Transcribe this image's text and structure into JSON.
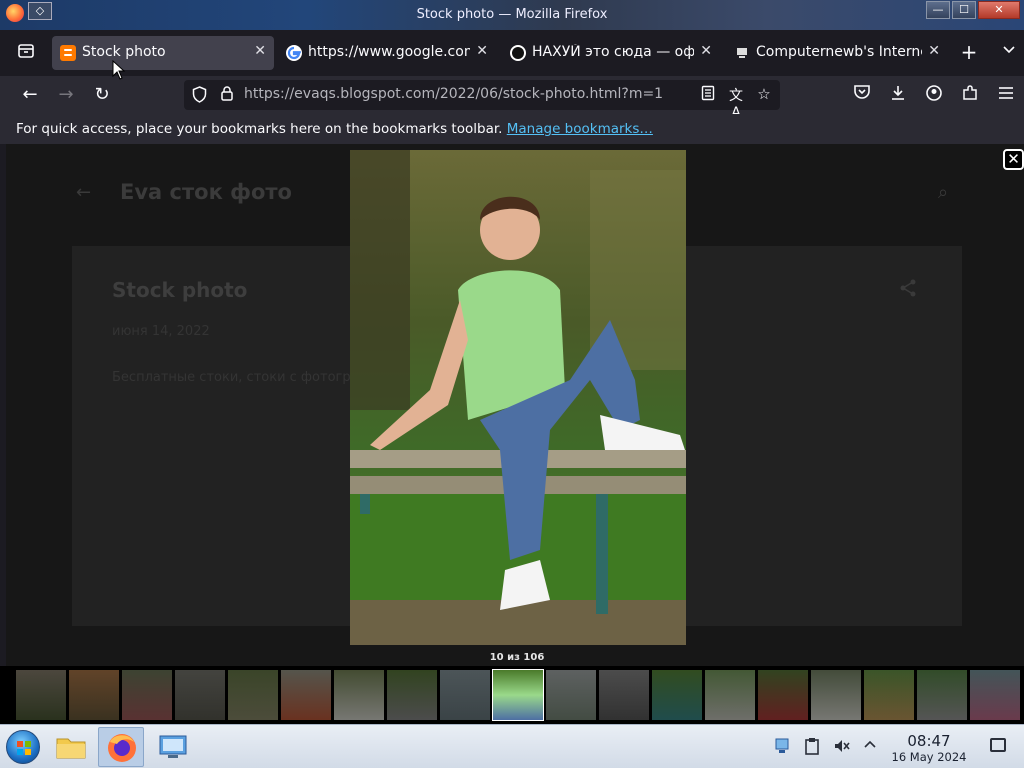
{
  "window": {
    "title": "Stock photo — Mozilla Firefox",
    "min_label": "—",
    "max_label": "☐",
    "close_label": "✕"
  },
  "tabs": [
    {
      "label": "Stock photo",
      "favicon": "blogger-icon",
      "active": true
    },
    {
      "label": "https://www.google.com/",
      "favicon": "google-icon",
      "active": false
    },
    {
      "label": "НАХУЙ это сюда — офи",
      "favicon": "github-icon",
      "active": false
    },
    {
      "label": "Computernewb's Internet",
      "favicon": "computernewb-icon",
      "active": false
    }
  ],
  "tab_close": "✕",
  "tab_new": "+",
  "tab_list": "⌄",
  "navbar": {
    "url_host": "https://evaqs.blogspot.com",
    "url_path": "/2022/06/stock-photo.html?m=1"
  },
  "bookmarks_bar": {
    "message": "For quick access, place your bookmarks here on the bookmarks toolbar.",
    "link": "Manage bookmarks…"
  },
  "page": {
    "blog_title": "Eva сток фото",
    "post_title": "Stock photo",
    "post_date": "июня 14, 2022",
    "post_body": "Бесплатные стоки, стоки с фотогр"
  },
  "lightbox": {
    "counter": "10 из 106",
    "close_label": "✕",
    "current_index": 10,
    "total": 106
  },
  "taskbar": {
    "time": "08:47",
    "date": "16 May 2024"
  },
  "colors": {
    "accent_link": "#54c0f5",
    "tab_active": "#42414d",
    "toolbar": "#2b2a33"
  }
}
